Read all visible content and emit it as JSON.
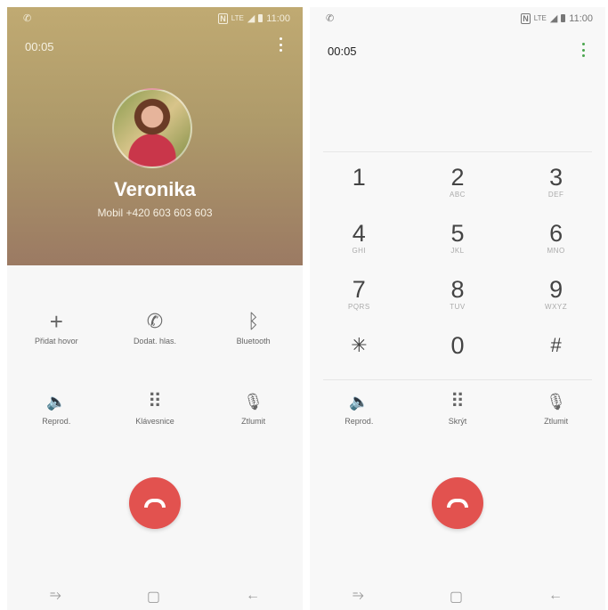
{
  "left": {
    "timer": "00:05",
    "contact_name": "Veronika",
    "contact_number": "Mobil  +420 603 603 603",
    "actions_row1": [
      {
        "label": "Přidat hovor",
        "icon": "plus-icon",
        "glyph": "+"
      },
      {
        "label": "Dodat. hlas.",
        "icon": "voicemail-call-icon",
        "glyph": "✆"
      },
      {
        "label": "Bluetooth",
        "icon": "bluetooth-icon",
        "glyph": "ᛒ"
      }
    ],
    "actions_row2": [
      {
        "label": "Reprod.",
        "icon": "speaker-icon",
        "glyph": "🔈"
      },
      {
        "label": "Klávesnice",
        "icon": "keypad-icon",
        "glyph": "⠿"
      },
      {
        "label": "Ztlumit",
        "icon": "mute-mic-icon",
        "glyph": "🎙"
      }
    ]
  },
  "right": {
    "timer": "00:05",
    "keys": [
      {
        "digit": "1",
        "letters": ""
      },
      {
        "digit": "2",
        "letters": "ABC"
      },
      {
        "digit": "3",
        "letters": "DEF"
      },
      {
        "digit": "4",
        "letters": "GHI"
      },
      {
        "digit": "5",
        "letters": "JKL"
      },
      {
        "digit": "6",
        "letters": "MNO"
      },
      {
        "digit": "7",
        "letters": "PQRS"
      },
      {
        "digit": "8",
        "letters": "TUV"
      },
      {
        "digit": "9",
        "letters": "WXYZ"
      },
      {
        "digit": "✳",
        "letters": ""
      },
      {
        "digit": "0",
        "letters": ""
      },
      {
        "digit": "#",
        "letters": ""
      }
    ],
    "actions": [
      {
        "label": "Reprod.",
        "icon": "speaker-icon",
        "glyph": "🔈"
      },
      {
        "label": "Skrýt",
        "icon": "keypad-icon",
        "glyph": "⠿"
      },
      {
        "label": "Ztlumit",
        "icon": "mute-mic-icon",
        "glyph": "🎙"
      }
    ]
  },
  "status": {
    "time": "11:00",
    "nfc": "N",
    "network": "LTE"
  },
  "colors": {
    "end_call": "#e2524f",
    "header_top": "#c0aa72",
    "header_bottom": "#9b7a63",
    "more_dots_right": "#4ba64f"
  },
  "nav_icons": [
    "recent-apps-icon",
    "home-icon",
    "back-icon"
  ]
}
